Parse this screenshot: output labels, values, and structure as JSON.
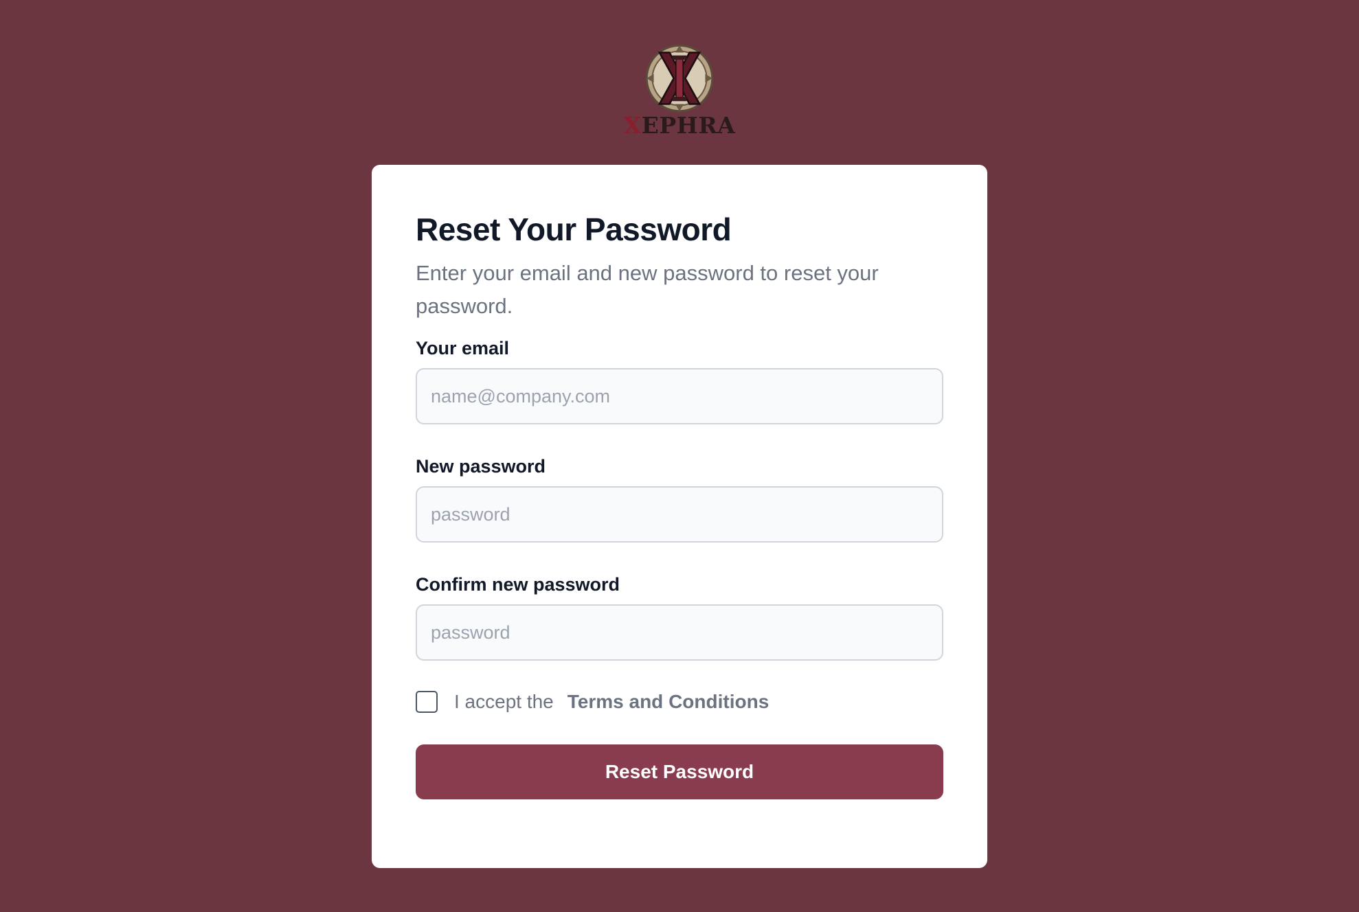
{
  "brand": {
    "name_first_letter": "X",
    "name_rest": "EPHRA",
    "emblem_icon": "crossed-x-emblem-icon",
    "colors": {
      "background": "#6c3640",
      "emblem_ring": "#c9b79a",
      "emblem_x": "#5a1a26",
      "name_accent": "#8a1e2c",
      "name_text": "#2b1a1c"
    }
  },
  "form": {
    "title": "Reset Your Password",
    "subtitle": "Enter your email and new password to reset your password.",
    "email": {
      "label": "Your email",
      "placeholder": "name@company.com",
      "value": ""
    },
    "new_password": {
      "label": "New password",
      "placeholder": "password",
      "value": ""
    },
    "confirm_password": {
      "label": "Confirm new password",
      "placeholder": "password",
      "value": ""
    },
    "terms": {
      "checked": false,
      "prefix": "I accept the",
      "link_label": "Terms and Conditions"
    },
    "submit_label": "Reset Password",
    "colors": {
      "primary_button": "#8a3c4f",
      "card": "#ffffff",
      "input_bg": "#f9fafb",
      "input_border": "#d1d5db"
    }
  }
}
